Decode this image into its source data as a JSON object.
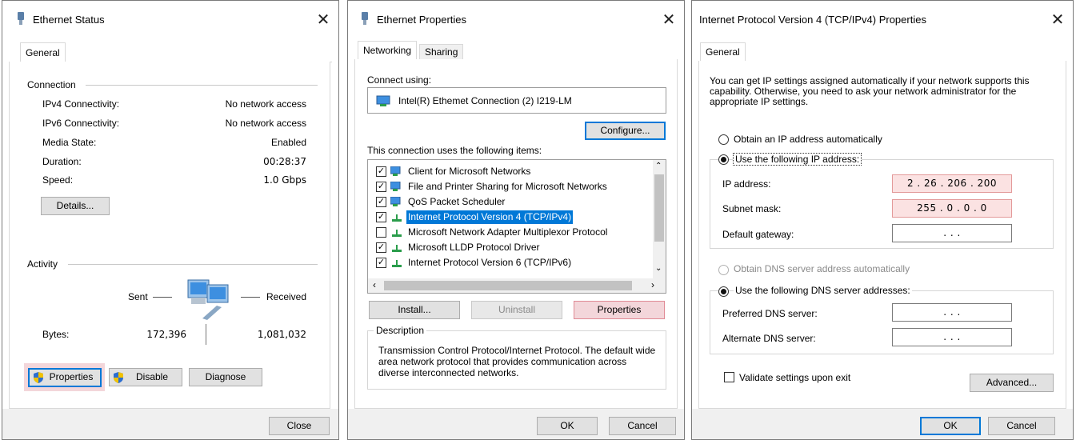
{
  "status": {
    "title": "Ethernet Status",
    "tab": "General",
    "connection_heading": "Connection",
    "rows": [
      {
        "label": "IPv4 Connectivity:",
        "value": "No network access"
      },
      {
        "label": "IPv6 Connectivity:",
        "value": "No network access"
      },
      {
        "label": "Media State:",
        "value": "Enabled"
      },
      {
        "label": "Duration:",
        "value": "00:28:37"
      },
      {
        "label": "Speed:",
        "value": "1.0 Gbps"
      }
    ],
    "details_btn": "Details...",
    "activity_heading": "Activity",
    "sent_label": "Sent",
    "received_label": "Received",
    "bytes_label": "Bytes:",
    "bytes_sent": "172,396",
    "bytes_received": "1,081,032",
    "properties_btn": "Properties",
    "disable_btn": "Disable",
    "diagnose_btn": "Diagnose",
    "close_btn": "Close"
  },
  "ethprops": {
    "title": "Ethernet Properties",
    "tabs": [
      "Networking",
      "Sharing"
    ],
    "connect_using": "Connect using:",
    "adapter": "Intel(R) Ethemet Connection (2) I219-LM",
    "configure_btn": "Configure...",
    "items_heading": "This connection uses the following items:",
    "items": [
      {
        "label": "Client for Microsoft Networks",
        "checked": true
      },
      {
        "label": "File and Printer Sharing for Microsoft Networks",
        "checked": true
      },
      {
        "label": "QoS Packet Scheduler",
        "checked": true
      },
      {
        "label": "Internet Protocol Version 4 (TCP/IPv4)",
        "checked": true
      },
      {
        "label": "Microsoft Network Adapter Multiplexor Protocol",
        "checked": false
      },
      {
        "label": "Microsoft LLDP Protocol Driver",
        "checked": true
      },
      {
        "label": "Internet Protocol Version 6 (TCP/IPv6)",
        "checked": true
      }
    ],
    "install_btn": "Install...",
    "uninstall_btn": "Uninstall",
    "properties_btn": "Properties",
    "description_heading": "Description",
    "description_text": "Transmission Control Protocol/Internet Protocol. The default wide area network protocol that provides communication across diverse interconnected networks.",
    "ok_btn": "OK",
    "cancel_btn": "Cancel"
  },
  "ipv4": {
    "title": "Internet Protocol Version 4 (TCP/IPv4) Properties",
    "tab": "General",
    "intro": "You can get IP settings assigned automatically if your network supports this capability. Otherwise, you need to ask your network administrator for the appropriate IP settings.",
    "obtain_ip_auto": "Obtain an IP address automatically",
    "use_following_ip": "Use the following IP address:",
    "ip_address_label": "IP address:",
    "ip_address_value": "2 . 26 . 206 . 200",
    "subnet_label": "Subnet mask:",
    "subnet_value": "255 . 0 . 0 . 0",
    "gateway_label": "Default gateway:",
    "gateway_value": ".       .       .",
    "obtain_dns_auto": "Obtain DNS server address automatically",
    "use_following_dns": "Use the following DNS server addresses:",
    "preferred_dns_label": "Preferred DNS server:",
    "preferred_dns_value": ".       .       .",
    "alternate_dns_label": "Alternate DNS server:",
    "alternate_dns_value": ".       .       .",
    "validate_label": "Validate settings upon exit",
    "advanced_btn": "Advanced...",
    "ok_btn": "OK",
    "cancel_btn": "Cancel"
  },
  "colors": {
    "selection": "#0078d7",
    "highlight_red": "#f3d6da"
  }
}
